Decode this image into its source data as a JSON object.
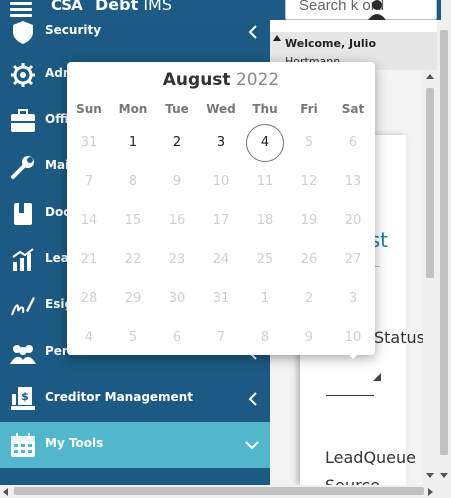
{
  "header": {
    "logo_text": "CSA",
    "title_prefix": "Debt",
    "title_suffix": "IMS",
    "search_value": "Search k      ord"
  },
  "sidebar": {
    "items": [
      {
        "label": "Security",
        "icon": "shield-icon",
        "chevron": "left"
      },
      {
        "label": "Adm",
        "icon": "gear-icon",
        "chevron": "none"
      },
      {
        "label": "Offi",
        "icon": "briefcase-icon",
        "chevron": "none"
      },
      {
        "label": "Mai",
        "icon": "wrench-icon",
        "chevron": "none"
      },
      {
        "label": "Doc",
        "icon": "book-icon",
        "chevron": "none"
      },
      {
        "label": "Lea",
        "icon": "chart-icon",
        "chevron": "none"
      },
      {
        "label": "Esig",
        "icon": "signature-icon",
        "chevron": "none"
      },
      {
        "label": "Pers",
        "icon": "people-icon",
        "chevron": "left"
      },
      {
        "label": "Creditor Management",
        "icon": "creditor-icon",
        "chevron": "left"
      },
      {
        "label": "My Tools",
        "icon": "calendar-icon",
        "chevron": "down",
        "active": true
      }
    ]
  },
  "main": {
    "welcome": "Welcome, Julio",
    "welcome_sub": "Hortmann",
    "card": {
      "checklist": "klist",
      "status": "Status",
      "lead_queue": "LeadQueue",
      "source": "Source"
    }
  },
  "datepicker": {
    "month": "August",
    "year": "2022",
    "weekdays": [
      "Sun",
      "Mon",
      "Tue",
      "Wed",
      "Thu",
      "Fri",
      "Sat"
    ],
    "days": [
      [
        "31",
        "1",
        "2",
        "3",
        "4",
        "5",
        "6"
      ],
      [
        "7",
        "8",
        "9",
        "10",
        "11",
        "12",
        "13"
      ],
      [
        "14",
        "15",
        "16",
        "17",
        "18",
        "19",
        "20"
      ],
      [
        "21",
        "22",
        "23",
        "24",
        "25",
        "26",
        "27"
      ],
      [
        "28",
        "29",
        "30",
        "31",
        "1",
        "2",
        "3"
      ],
      [
        "4",
        "5",
        "6",
        "7",
        "8",
        "9",
        "10"
      ]
    ],
    "enabled": [
      [
        false,
        true,
        true,
        true,
        true,
        false,
        false
      ],
      [
        false,
        false,
        false,
        false,
        false,
        false,
        false
      ],
      [
        false,
        false,
        false,
        false,
        false,
        false,
        false
      ],
      [
        false,
        false,
        false,
        false,
        false,
        false,
        false
      ],
      [
        false,
        false,
        false,
        false,
        false,
        false,
        false
      ],
      [
        false,
        false,
        false,
        false,
        false,
        false,
        false
      ]
    ],
    "selected_day": "4"
  },
  "colors": {
    "sidebar_bg": "#1c5a83",
    "active_item_bg": "#52b7cc",
    "accent_text": "#1b7fa3"
  }
}
